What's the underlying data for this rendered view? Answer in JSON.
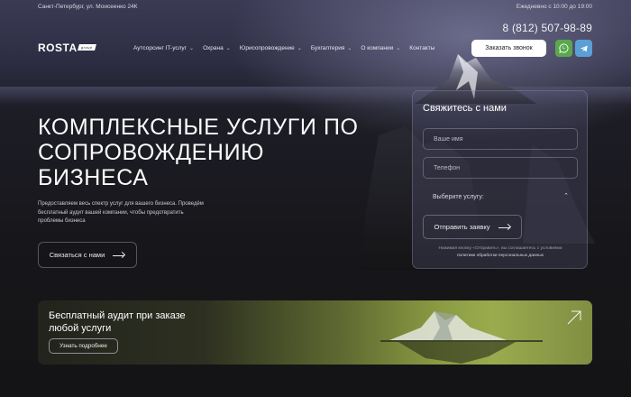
{
  "topbar": {
    "address": "Санкт-Петербург, ул. Моисеенко 24К",
    "hours": "Ежедневно с 10:00 до 19:00"
  },
  "header": {
    "phone": "8 (812) 507-98-89",
    "logo": {
      "text": "ROSTA",
      "tag": "group"
    },
    "nav": [
      {
        "label": "Аутсорсинг IT-услуг",
        "has_dropdown": true
      },
      {
        "label": "Охрана",
        "has_dropdown": true
      },
      {
        "label": "Юрисопровождение",
        "has_dropdown": true
      },
      {
        "label": "Бухгалтерия",
        "has_dropdown": true
      },
      {
        "label": "О компании",
        "has_dropdown": true
      },
      {
        "label": "Контакты",
        "has_dropdown": false
      }
    ],
    "call_button": "Заказать звонок",
    "social": [
      {
        "name": "whatsapp-icon",
        "color": "#5aa84e"
      },
      {
        "name": "telegram-icon",
        "color": "#5c9fd6"
      }
    ]
  },
  "hero": {
    "title_lines": [
      "Комплексные услуги по",
      "сопровождению",
      "бизнеса"
    ],
    "description_lines": [
      "Предоставляем весь спектр услуг для вашего бизнеса. Проведём",
      "бесплатный аудит вашей компании, чтобы предотвратить",
      "проблемы бизнеса"
    ],
    "contact_button": "Связаться с нами"
  },
  "form": {
    "title": "Свяжитесь с нами",
    "name_placeholder": "Ваше имя",
    "phone_placeholder": "Телефон",
    "service_select": "Выберите услугу:",
    "submit": "Отправить заявку",
    "consent_text": "Нажимая кнопку «Отправить», вы соглашаетесь с условиями",
    "consent_link": "политики обработки персональных данных"
  },
  "banner": {
    "title_lines": [
      "Бесплатный аудит при заказе",
      "любой услуги"
    ],
    "button": "Узнать подробнее"
  },
  "colors": {
    "background": "#141416",
    "whatsapp": "#5aa84e",
    "telegram": "#5c9fd6",
    "banner_accent": "#9aab4e"
  }
}
